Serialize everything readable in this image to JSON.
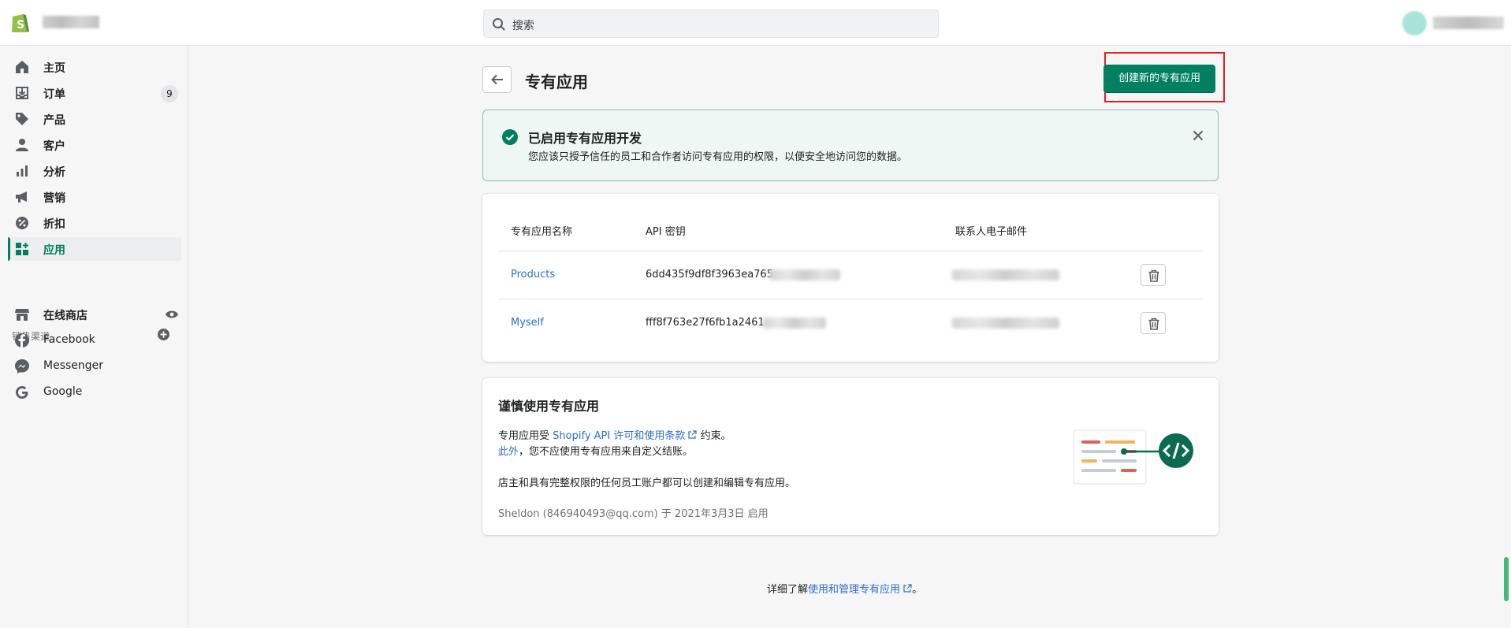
{
  "topbar": {
    "search_placeholder": "搜索"
  },
  "sidebar": {
    "items": [
      {
        "label": "主页",
        "icon": "home-icon"
      },
      {
        "label": "订单",
        "icon": "orders-icon",
        "badge": "9"
      },
      {
        "label": "产品",
        "icon": "tag-icon"
      },
      {
        "label": "客户",
        "icon": "customer-icon"
      },
      {
        "label": "分析",
        "icon": "analytics-icon"
      },
      {
        "label": "营销",
        "icon": "megaphone-icon"
      },
      {
        "label": "折扣",
        "icon": "discount-icon"
      },
      {
        "label": "应用",
        "icon": "apps-icon",
        "active": true
      }
    ],
    "sales_channels_title": "销售渠道",
    "channels": [
      {
        "label": "在线商店",
        "icon": "store-icon"
      },
      {
        "label": "Facebook",
        "icon": "facebook-icon"
      },
      {
        "label": "Messenger",
        "icon": "messenger-icon"
      },
      {
        "label": "Google",
        "icon": "google-icon"
      }
    ]
  },
  "page": {
    "title": "专有应用",
    "create_button": "创建新的专有应用"
  },
  "banner": {
    "title": "已启用专有应用开发",
    "text": "您应该只授予信任的员工和合作者访问专有应用的权限，以便安全地访问您的数据。"
  },
  "table": {
    "headers": [
      "专有应用名称",
      "API 密钥",
      "联系人电子邮件"
    ],
    "rows": [
      {
        "name": "Products",
        "api_key": "6dd435f9df8f3963ea765"
      },
      {
        "name": "Myself",
        "api_key": "fff8f763e27f6fb1a2461"
      }
    ]
  },
  "info": {
    "title": "谨慎使用专有应用",
    "line1_prefix": "专用应用受",
    "line1_link": "Shopify API 许可和使用条款",
    "line1_suffix": "约束。",
    "line2_link": "此外",
    "line2_suffix": "，您不应使用专有应用来自定义结账。",
    "line3": "店主和具有完整权限的任何员工账户都可以创建和编辑专有应用。",
    "enabled_by": "Sheldon (846940493@qq.com) 于 2021年3月3日 启用"
  },
  "footer": {
    "prefix": "详细了解",
    "link": "使用和管理专有应用",
    "suffix": "。"
  },
  "colors": {
    "primary": "#008060",
    "link": "#2c6ecb",
    "highlight": "#e22020",
    "banner_bg": "#eef7f3"
  }
}
